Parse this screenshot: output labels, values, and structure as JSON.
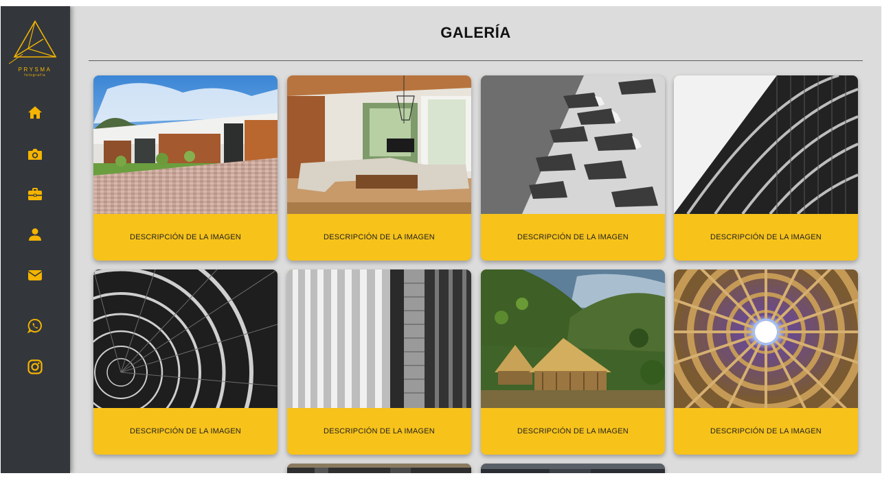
{
  "brand": {
    "name": "PRYSMA",
    "subtitle": "fotografía",
    "accent_color": "#f4b400"
  },
  "sidebar": {
    "background": "#33373c",
    "items": [
      {
        "icon": "home-icon"
      },
      {
        "icon": "camera-icon"
      },
      {
        "icon": "briefcase-icon"
      },
      {
        "icon": "user-icon"
      },
      {
        "icon": "envelope-icon"
      },
      {
        "icon": "whatsapp-icon"
      },
      {
        "icon": "instagram-icon"
      }
    ]
  },
  "page": {
    "title": "GALERÍA",
    "background": "#dcdcdc"
  },
  "gallery": {
    "caption_color": "#f7c21a",
    "cards": [
      {
        "caption": "DESCRIPCIÓN DE LA IMAGEN",
        "image": "modern-house-exterior"
      },
      {
        "caption": "DESCRIPCIÓN DE LA IMAGEN",
        "image": "living-room-interior"
      },
      {
        "caption": "DESCRIPCIÓN DE LA IMAGEN",
        "image": "concrete-facade-bw"
      },
      {
        "caption": "DESCRIPCIÓN DE LA IMAGEN",
        "image": "curved-building-bw"
      },
      {
        "caption": "DESCRIPCIÓN DE LA IMAGEN",
        "image": "spiral-staircase-bw"
      },
      {
        "caption": "DESCRIPCIÓN DE LA IMAGEN",
        "image": "vertical-slats-bw"
      },
      {
        "caption": "DESCRIPCIÓN DE LA IMAGEN",
        "image": "bamboo-huts-mountains"
      },
      {
        "caption": "DESCRIPCIÓN DE LA IMAGEN",
        "image": "radial-wood-ceiling"
      }
    ]
  }
}
